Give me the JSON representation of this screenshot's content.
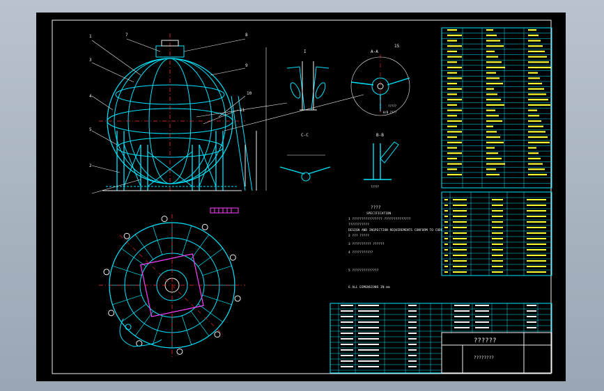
{
  "drawing": {
    "title": "??????",
    "subtitle": "????????",
    "view_labels": [
      "I",
      "A-A",
      "B-B",
      "C-C"
    ],
    "balloons": [
      "7",
      "8",
      "9",
      "3",
      "4",
      "5",
      "2",
      "1",
      "15",
      "10",
      "11"
    ],
    "notes_heading": "????",
    "notes_sub": "SPECIFICATION",
    "notes_lines": [
      "1  ????????????????  ??????????????",
      "   ???????????",
      "   DESIGN AND INSPECTION REQUIREMENTS CONFORM TO CODE",
      "2  ???  ?????",
      "3  ??????????  ??????",
      "4  ???????????",
      "5  ??????????????",
      "6  ALL DIMENSIONS IN mm"
    ],
    "colors": {
      "background": "#000000",
      "outline": "#00e5ff",
      "text": "#ffff33",
      "white": "#f2f2f2"
    }
  }
}
